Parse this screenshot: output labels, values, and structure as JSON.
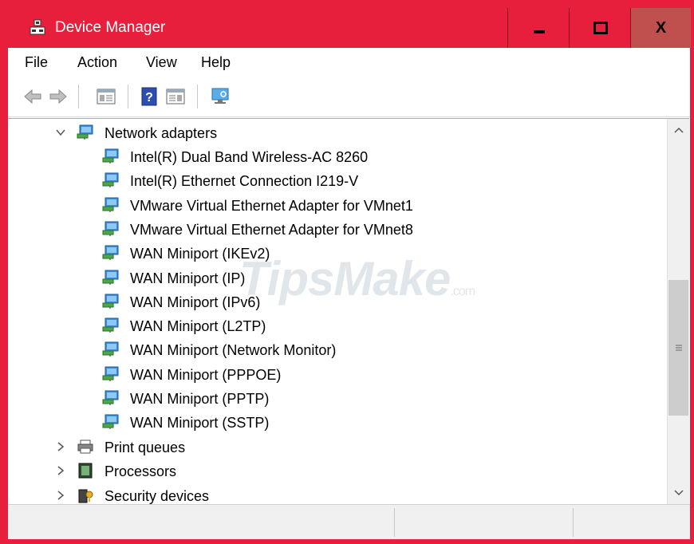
{
  "window": {
    "title": "Device Manager",
    "accent": "#e81f3c",
    "minimize_label": "minimize",
    "maximize_label": "maximize",
    "close_label": "X"
  },
  "menu": {
    "items": [
      {
        "label": "File"
      },
      {
        "label": "Action"
      },
      {
        "label": "View"
      },
      {
        "label": "Help"
      }
    ]
  },
  "toolbar": {
    "buttons": [
      {
        "icon": "back-arrow-icon"
      },
      {
        "icon": "forward-arrow-icon"
      },
      {
        "icon": "properties-console-icon"
      },
      {
        "icon": "help-icon"
      },
      {
        "icon": "update-driver-icon"
      },
      {
        "icon": "scan-hardware-icon"
      }
    ]
  },
  "tree": {
    "category": {
      "label": "Network adapters",
      "expanded": true,
      "icon": "network-adapter-icon"
    },
    "adapters": [
      "Intel(R) Dual Band Wireless-AC 8260",
      "Intel(R) Ethernet Connection I219-V",
      "VMware Virtual Ethernet Adapter for VMnet1",
      "VMware Virtual Ethernet Adapter for VMnet8",
      "WAN Miniport (IKEv2)",
      "WAN Miniport (IP)",
      "WAN Miniport (IPv6)",
      "WAN Miniport (L2TP)",
      "WAN Miniport (Network Monitor)",
      "WAN Miniport (PPPOE)",
      "WAN Miniport (PPTP)",
      "WAN Miniport (SSTP)"
    ],
    "collapsed": [
      {
        "label": "Print queues",
        "icon": "printer-icon"
      },
      {
        "label": "Processors",
        "icon": "processor-icon"
      },
      {
        "label": "Security devices",
        "icon": "security-device-icon"
      }
    ]
  },
  "watermark": {
    "main": "TipsMake",
    "suffix": ".com"
  }
}
